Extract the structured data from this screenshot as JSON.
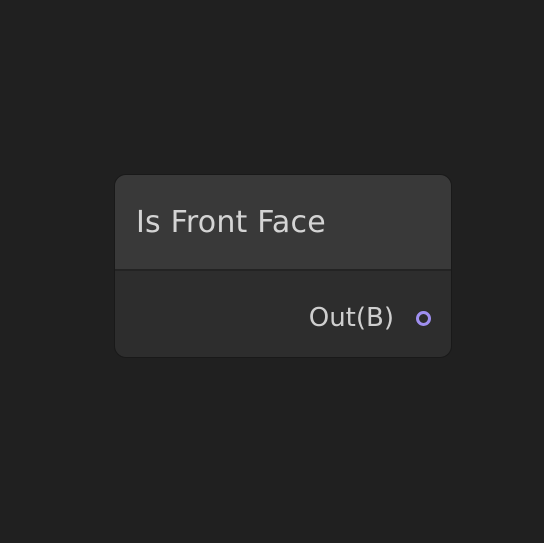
{
  "node": {
    "title": "Is Front Face",
    "output_port": {
      "label": "Out(B)",
      "color": "#9f8ff0"
    }
  },
  "colors": {
    "canvas_background": "#202020",
    "node_header": "#393939",
    "node_body": "#2d2d2d"
  }
}
